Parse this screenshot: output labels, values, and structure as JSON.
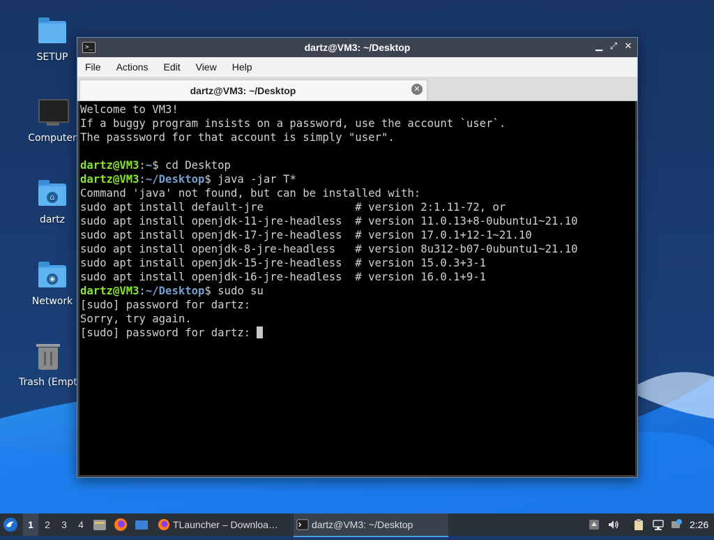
{
  "desktop": {
    "icons": [
      {
        "label": "SETUP",
        "icon": "folder-icon"
      },
      {
        "label": "Computer",
        "icon": "computer-icon"
      },
      {
        "label": "dartz",
        "icon": "home-folder-icon"
      },
      {
        "label": "Network",
        "icon": "network-folder-icon"
      },
      {
        "label": "Trash (Empty)",
        "icon": "trash-icon"
      }
    ]
  },
  "window": {
    "title": "dartz@VM3: ~/Desktop",
    "menu": [
      "File",
      "Actions",
      "Edit",
      "View",
      "Help"
    ],
    "tab_label": "dartz@VM3: ~/Desktop",
    "controls": {
      "minimize": "▁",
      "maximize": "⤢",
      "close": "✕"
    }
  },
  "terminal": {
    "lines": [
      {
        "text": "Welcome to VM3!"
      },
      {
        "text": "If a buggy program insists on a password, use the account `user`."
      },
      {
        "text": "The passsword for that account is simply \"user\"."
      },
      {
        "text": ""
      },
      {
        "user": "dartz@VM3",
        "path": "~",
        "text": "$ cd Desktop"
      },
      {
        "user": "dartz@VM3",
        "path": "~/Desktop",
        "text": "$ java -jar T*"
      },
      {
        "text": "Command 'java' not found, but can be installed with:"
      },
      {
        "text": "sudo apt install default-jre              # version 2:1.11-72, or"
      },
      {
        "text": "sudo apt install openjdk-11-jre-headless  # version 11.0.13+8-0ubuntu1~21.10"
      },
      {
        "text": "sudo apt install openjdk-17-jre-headless  # version 17.0.1+12-1~21.10"
      },
      {
        "text": "sudo apt install openjdk-8-jre-headless   # version 8u312-b07-0ubuntu1~21.10"
      },
      {
        "text": "sudo apt install openjdk-15-jre-headless  # version 15.0.3+3-1"
      },
      {
        "text": "sudo apt install openjdk-16-jre-headless  # version 16.0.1+9-1"
      },
      {
        "user": "dartz@VM3",
        "path": "~/Desktop",
        "text": "$ sudo su"
      },
      {
        "text": "[sudo] password for dartz:"
      },
      {
        "text": "Sorry, try again."
      },
      {
        "text": "[sudo] password for dartz: ",
        "cursor": true
      }
    ]
  },
  "taskbar": {
    "workspaces": [
      "1",
      "2",
      "3",
      "4"
    ],
    "active_workspace": "1",
    "tasks": [
      {
        "label": "TLauncher – Downloa…",
        "icon": "firefox-icon"
      },
      {
        "label": "dartz@VM3: ~/Desktop",
        "icon": "terminal-icon",
        "active": true
      }
    ],
    "clock": "2:26"
  },
  "colors": {
    "prompt_user": "#8ae234",
    "prompt_path": "#729fcf",
    "terminal_bg": "#000000",
    "taskbar_bg": "#2a3038"
  }
}
